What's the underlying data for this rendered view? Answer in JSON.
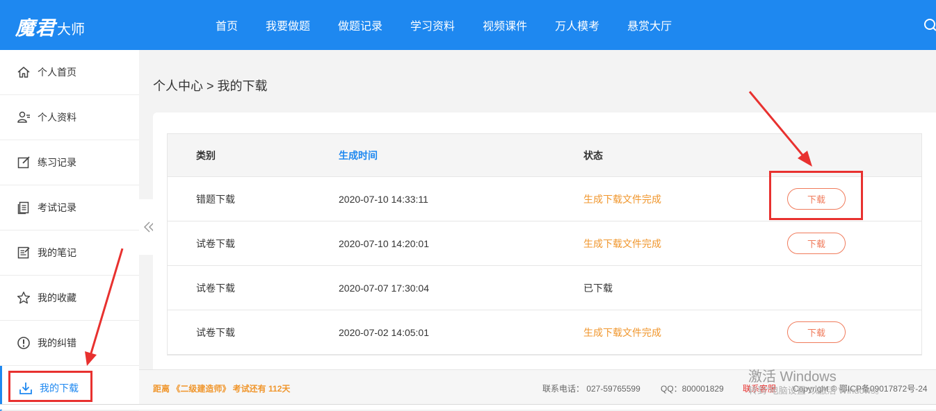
{
  "header": {
    "logo_brand": "魔君",
    "logo_suffix": "大师",
    "nav": [
      "首页",
      "我要做题",
      "做题记录",
      "学习资料",
      "视频课件",
      "万人模考",
      "悬赏大厅"
    ],
    "accent_color": "#1e88f0"
  },
  "sidebar": {
    "items": [
      {
        "label": "个人首页",
        "icon": "home-icon"
      },
      {
        "label": "个人资料",
        "icon": "user-profile-icon"
      },
      {
        "label": "练习记录",
        "icon": "edit-icon"
      },
      {
        "label": "考试记录",
        "icon": "document-list-icon"
      },
      {
        "label": "我的笔记",
        "icon": "notes-icon"
      },
      {
        "label": "我的收藏",
        "icon": "star-icon"
      },
      {
        "label": "我的纠错",
        "icon": "alert-icon"
      },
      {
        "label": "我的下载",
        "icon": "download-icon",
        "active": true
      }
    ]
  },
  "breadcrumb": "个人中心 > 我的下载",
  "table": {
    "headers": [
      "类别",
      "生成时间",
      "状态",
      ""
    ],
    "rows": [
      {
        "category": "错题下载",
        "time": "2020-07-10 14:33:11",
        "status": "生成下载文件完成",
        "action": "下载"
      },
      {
        "category": "试卷下载",
        "time": "2020-07-10 14:20:01",
        "status": "生成下载文件完成",
        "action": "下载"
      },
      {
        "category": "试卷下载",
        "time": "2020-07-07 17:30:04",
        "status": "已下载",
        "action": ""
      },
      {
        "category": "试卷下载",
        "time": "2020-07-02 14:05:01",
        "status": "生成下载文件完成",
        "action": "下载"
      }
    ]
  },
  "footer": {
    "countdown": "距离 《二级建造师》 考试还有 112天",
    "phone": "联系电话： 027-59765599",
    "qq": "QQ：800001829",
    "service": "联系客服",
    "copyright": "Copyright © 鄂ICP备09017872号-24"
  },
  "watermark": {
    "title": "激活 Windows",
    "subtitle": "转到\"电脑设置\"以激活 Windows。"
  },
  "colors": {
    "status_orange": "#f0962c",
    "button_outline": "#f07a5a",
    "annotation_red": "#e8312f"
  }
}
